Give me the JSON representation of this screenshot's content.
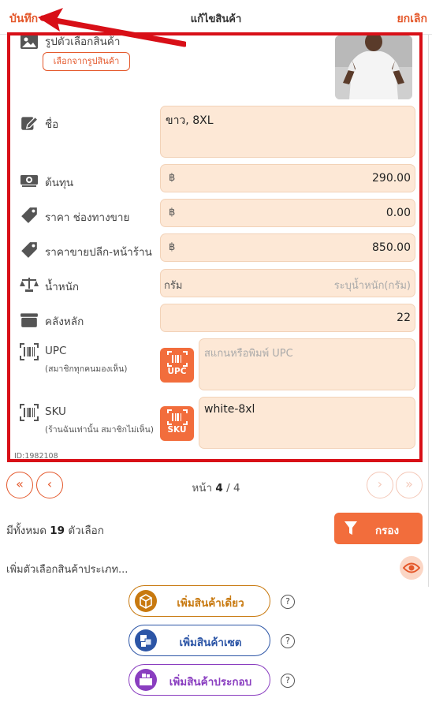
{
  "header": {
    "save_label": "บันทึก",
    "title": "แก้ไขสินค้า",
    "cancel_label": "ยกเลิก"
  },
  "photo": {
    "label": "รูปตัวเลือกสินค้า",
    "choose_label": "เลือกจากรูปสินค้า"
  },
  "fields": {
    "name": {
      "label": "ชื่อ",
      "value": "ขาว, 8XL"
    },
    "cost": {
      "label": "ต้นทุน",
      "currency": "฿",
      "value": "290.00"
    },
    "price_channel": {
      "label": "ราคา ช่องทางขาย",
      "currency": "฿",
      "value": "0.00"
    },
    "price_retail": {
      "label": "ราคาขายปลีก-หน้าร้าน",
      "currency": "฿",
      "value": "850.00"
    },
    "weight": {
      "label": "น้ำหนัก",
      "unit": "กรัม",
      "placeholder": "ระบุน้ำหนัก(กรัม)"
    },
    "warehouse": {
      "label": "คลังหลัก",
      "value": "22"
    },
    "upc": {
      "label": "UPC",
      "sublabel": "(สมาชิกทุกคนมองเห็น)",
      "button": "UPC",
      "placeholder": "สแกนหรือพิมพ์ UPC"
    },
    "sku": {
      "label": "SKU",
      "sublabel": "(ร้านฉันเท่านั้น สมาชิกไม่เห็น)",
      "button": "SKU",
      "value": "white-8xl"
    }
  },
  "id_text": "ID:1982108",
  "pager": {
    "page_label": "หน้า",
    "current": "4",
    "separator": "/",
    "total": "4"
  },
  "summary": {
    "prefix": "มีทั้งหมด",
    "count": "19",
    "suffix": "ตัวเลือก"
  },
  "filter_label": "กรอง",
  "add_type_label": "เพิ่มตัวเลือกสินค้าประเภท...",
  "add_buttons": {
    "single": "เพิ่มสินค้าเดี่ยว",
    "set": "เพิ่มสินค้าเซต",
    "composite": "เพิ่มสินค้าประกอบ"
  },
  "help_mark": "?",
  "colors": {
    "accent": "#f26d3c",
    "accent_text": "#e4582b",
    "field_bg": "#fde8d6",
    "highlight_border": "#d80f17",
    "single_color": "#c8790f",
    "set_color": "#2c55a6",
    "composite_color": "#8a3ec0"
  },
  "icons": [
    "image-icon",
    "edit-icon",
    "money-icon",
    "tag-icon",
    "tag-icon",
    "scale-icon",
    "box-icon",
    "barcode-icon",
    "barcode-icon",
    "filter-icon",
    "eye-icon",
    "help-icon"
  ]
}
